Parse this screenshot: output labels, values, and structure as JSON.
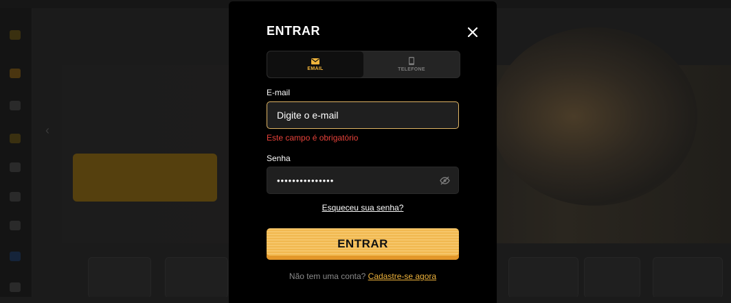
{
  "modal": {
    "title": "ENTRAR",
    "tabs": [
      {
        "label": "EMAIL",
        "icon": "envelope-icon",
        "active": true
      },
      {
        "label": "TELEFONE",
        "icon": "phone-icon",
        "active": false
      }
    ],
    "email": {
      "label": "E-mail",
      "placeholder": "Digite o e-mail",
      "value": "",
      "error": "Este campo é obrigatório"
    },
    "password": {
      "label": "Senha",
      "value": "•••••••••••••••",
      "visibility_icon": "eye-off-icon"
    },
    "forgot_link": "Esqueceu sua senha?",
    "submit_label": "ENTRAR",
    "signup": {
      "question": "Não tem uma conta?",
      "link": "Cadastre-se agora"
    }
  },
  "colors": {
    "accent": "#f0b43c",
    "error": "#e8423a",
    "modal_bg": "#000000",
    "input_bg": "#1f1f1f",
    "focus_border": "#e2b766"
  }
}
